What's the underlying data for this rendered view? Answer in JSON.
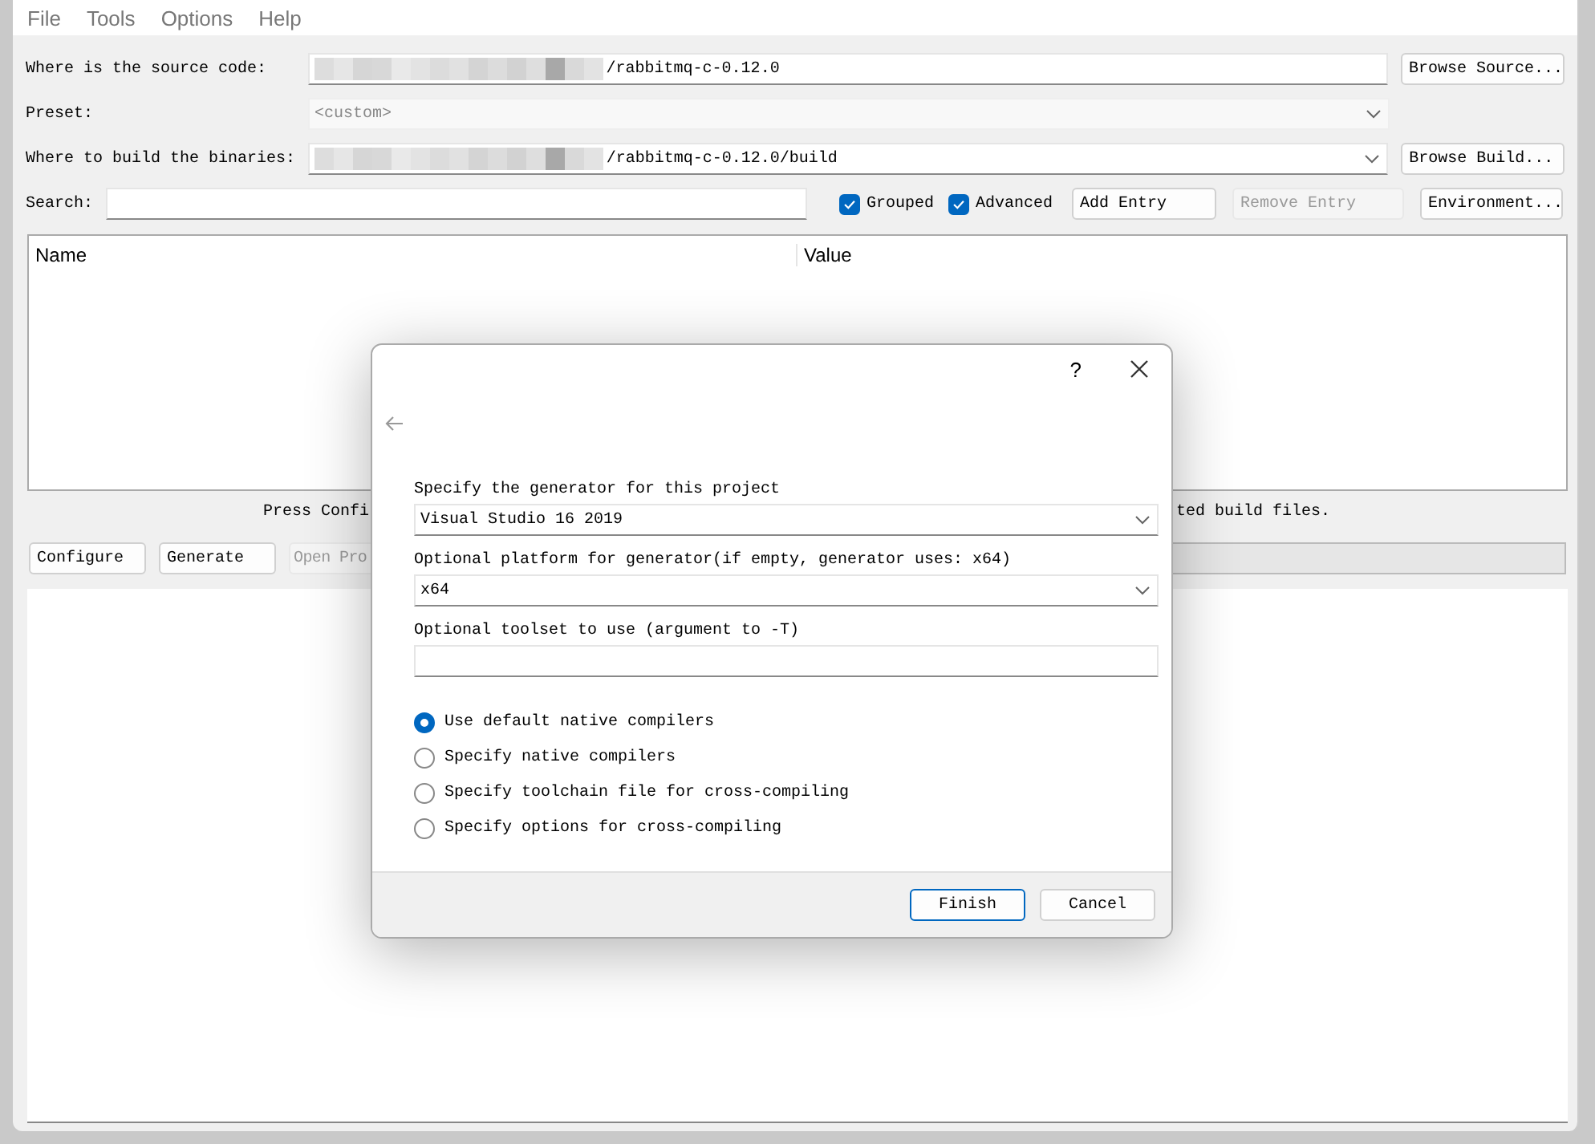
{
  "menu": [
    "File",
    "Tools",
    "Options",
    "Help"
  ],
  "source": {
    "label": "Where is the source code:",
    "value": "/rabbitmq-c-0.12.0",
    "button": "Browse Source..."
  },
  "preset": {
    "label": "Preset:",
    "placeholder": "<custom>",
    "disabled": true
  },
  "build": {
    "label": "Where to build the binaries:",
    "value": "/rabbitmq-c-0.12.0/build",
    "button": "Browse Build..."
  },
  "search": {
    "label": "Search:"
  },
  "options": [
    {
      "label": "Grouped",
      "checked": true
    },
    {
      "label": "Advanced",
      "checked": true
    }
  ],
  "entry_buttons": [
    {
      "label": "Add Entry",
      "disabled": false
    },
    {
      "label": "Remove Entry",
      "disabled": true
    },
    {
      "label": "Environment...",
      "disabled": false
    }
  ],
  "table": {
    "columns": [
      "Name",
      "Value"
    ]
  },
  "status_parts": [
    "Press Confi",
    "ted build files."
  ],
  "actions": [
    {
      "label": "Configure",
      "disabled": false
    },
    {
      "label": "Generate",
      "disabled": false
    },
    {
      "label": "Open Pro",
      "disabled": true
    }
  ],
  "progress_bar": {
    "level": 0
  },
  "dialog": {
    "help": "?",
    "generator_label": "Specify the generator for this project",
    "generator": "Visual Studio 16 2019",
    "platform_label": "Optional platform for generator(if empty, generator uses: x64)",
    "platform": "x64",
    "toolset_label": "Optional toolset to use (argument to -T)",
    "radios": [
      {
        "label": "Use default native compilers",
        "selected": true
      },
      {
        "label": "Specify native compilers",
        "selected": false
      },
      {
        "label": "Specify toolchain file for cross-compiling",
        "selected": false
      },
      {
        "label": "Specify options for cross-compiling",
        "selected": false
      }
    ],
    "buttons": [
      {
        "label": "Finish",
        "default": true
      },
      {
        "label": "Cancel",
        "default": false
      }
    ]
  }
}
